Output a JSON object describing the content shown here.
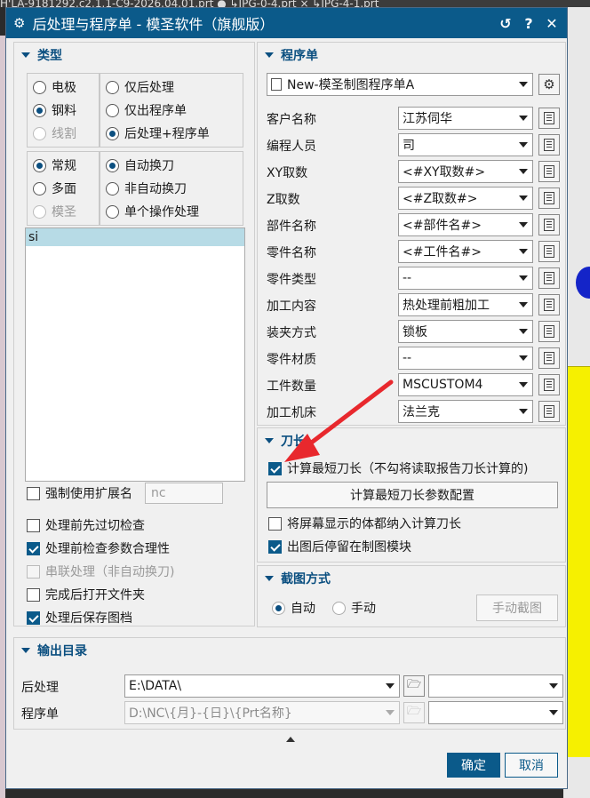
{
  "background": {
    "top_strip_text": "H'LA-9181292.c2.1.1-C9-2026.04.01.prt ●     ↳JPG-0-4.prt ×     ↳JPG-4-1.prt"
  },
  "window": {
    "title": "后处理与程序单 - 模圣软件（旗舰版）",
    "icons": [
      "gear-icon",
      "reset-icon",
      "help-icon",
      "close-icon"
    ],
    "reset_glyph": "↺",
    "help_glyph": "?",
    "close_glyph": "✕"
  },
  "type_section": {
    "header": "类型",
    "group1": [
      {
        "label": "电极",
        "selected": false,
        "enabled": true
      },
      {
        "label": "钢料",
        "selected": true,
        "enabled": true
      },
      {
        "label": "线割",
        "selected": false,
        "enabled": false
      }
    ],
    "group2": [
      {
        "label": "仅后处理",
        "selected": false
      },
      {
        "label": "仅出程序单",
        "selected": false
      },
      {
        "label": "后处理+程序单",
        "selected": true
      }
    ],
    "group3": [
      {
        "label": "常规",
        "selected": true,
        "enabled": true
      },
      {
        "label": "多面",
        "selected": false,
        "enabled": true
      },
      {
        "label": "模圣",
        "selected": false,
        "enabled": false
      }
    ],
    "group4": [
      {
        "label": "自动换刀",
        "selected": true
      },
      {
        "label": "非自动换刀",
        "selected": false
      },
      {
        "label": "单个操作处理",
        "selected": false
      }
    ],
    "list_items": [
      "si"
    ],
    "force_ext": {
      "label": "强制使用扩展名",
      "checked": false,
      "value": "nc"
    },
    "options": [
      {
        "label": "处理前先过切检查",
        "checked": false,
        "enabled": true
      },
      {
        "label": "处理前检查参数合理性",
        "checked": true,
        "enabled": true
      },
      {
        "label": "串联处理（非自动换刀)",
        "checked": false,
        "enabled": false
      },
      {
        "label": "完成后打开文件夹",
        "checked": false,
        "enabled": true
      },
      {
        "label": "处理后保存图档",
        "checked": true,
        "enabled": true
      }
    ]
  },
  "program_sheet": {
    "header": "程序单",
    "template": "New-模圣制图程序单A",
    "fields": [
      {
        "label": "客户名称",
        "value": "江苏伺华"
      },
      {
        "label": "编程人员",
        "value": "司"
      },
      {
        "label": "XY取数",
        "value": "<#XY取数#>"
      },
      {
        "label": "Z取数",
        "value": "<#Z取数#>"
      },
      {
        "label": "部件名称",
        "value": "<#部件名#>"
      },
      {
        "label": "零件名称",
        "value": "<#工件名#>"
      },
      {
        "label": "零件类型",
        "value": "--"
      },
      {
        "label": "加工内容",
        "value": "热处理前粗加工"
      },
      {
        "label": "装夹方式",
        "value": "锁板"
      },
      {
        "label": "零件材质",
        "value": "--"
      },
      {
        "label": "工件数量",
        "value": "MSCUSTOM4"
      },
      {
        "label": "加工机床",
        "value": "法兰克"
      }
    ]
  },
  "tool_length": {
    "header": "刀长",
    "calc_shortest": {
      "label": "计算最短刀长（不勾将读取报告刀长计算的)",
      "checked": true
    },
    "config_button": "计算最短刀长参数配置",
    "include_visible": {
      "label": "将屏幕显示的体都纳入计算刀长",
      "checked": false
    },
    "stay_in_drafting": {
      "label": "出图后停留在制图模块",
      "checked": true
    }
  },
  "screenshot_mode": {
    "header": "截图方式",
    "options": [
      {
        "label": "自动",
        "selected": true
      },
      {
        "label": "手动",
        "selected": false
      }
    ],
    "manual_button": "手动截图"
  },
  "output_dir": {
    "header": "输出目录",
    "post_label": "后处理",
    "post_path": "E:\\DATA\\",
    "sheet_label": "程序单",
    "sheet_path": "D:\\NC\\{月}-{日}\\{Prt名称}"
  },
  "footer": {
    "ok": "确定",
    "cancel": "取消"
  },
  "colors": {
    "title_bar": "#0b5a8a",
    "section_header": "#0b4f80",
    "annotation_arrow": "#e8282d"
  }
}
